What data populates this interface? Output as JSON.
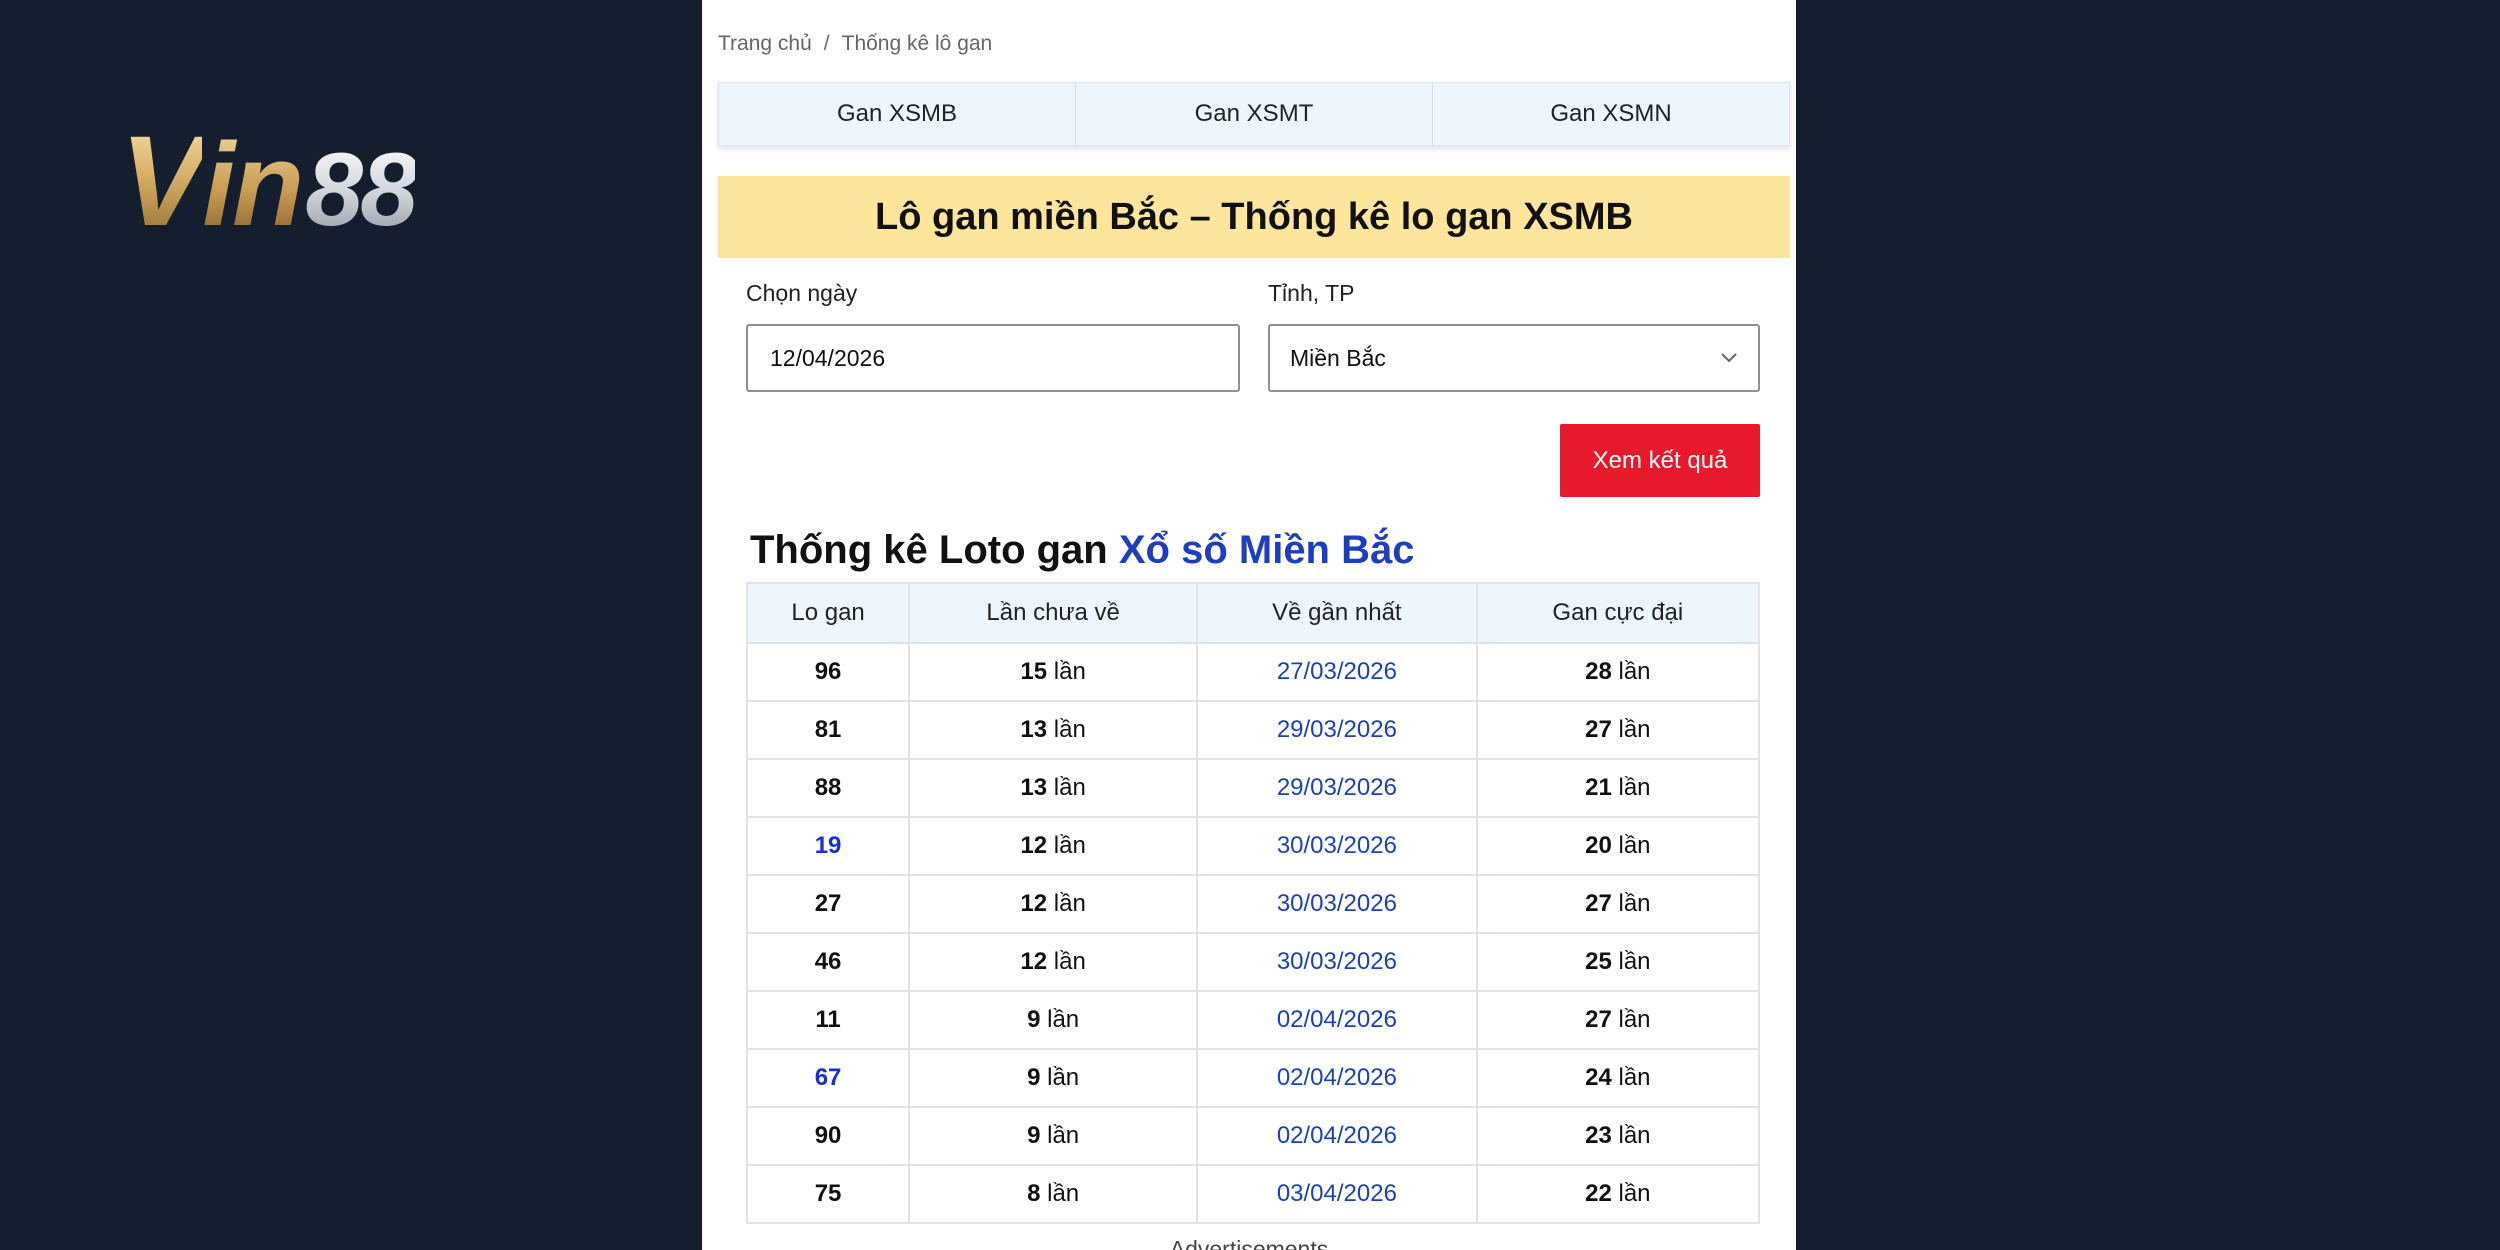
{
  "brand": {
    "logo_v": "V",
    "logo_in": "in",
    "logo_num": "88"
  },
  "breadcrumb": {
    "home": "Trang chủ",
    "separator": "/",
    "current": "Thống kê lô gan"
  },
  "tabs": [
    {
      "label": "Gan XSMB"
    },
    {
      "label": "Gan XSMT"
    },
    {
      "label": "Gan XSMN"
    }
  ],
  "page_title": "Lô gan miền Bắc – Thống kê lo gan XSMB",
  "form": {
    "date_label": "Chọn ngày",
    "date_value": "12/04/2026",
    "province_label": "Tỉnh, TP",
    "province_value": "Miền Bắc",
    "submit_label": "Xem kết quả"
  },
  "section": {
    "title_prefix": "Thống kê Loto gan",
    "title_highlight": "Xổ số Miền Bắc"
  },
  "table": {
    "headers": [
      "Lo gan",
      "Lần chưa về",
      "Về gần nhất",
      "Gan cực đại"
    ],
    "unit": "lần",
    "rows": [
      {
        "lo": "96",
        "count": "15",
        "last": "27/03/2026",
        "max": "28",
        "highlight": false
      },
      {
        "lo": "81",
        "count": "13",
        "last": "29/03/2026",
        "max": "27",
        "highlight": false
      },
      {
        "lo": "88",
        "count": "13",
        "last": "29/03/2026",
        "max": "21",
        "highlight": false
      },
      {
        "lo": "19",
        "count": "12",
        "last": "30/03/2026",
        "max": "20",
        "highlight": true
      },
      {
        "lo": "27",
        "count": "12",
        "last": "30/03/2026",
        "max": "27",
        "highlight": false
      },
      {
        "lo": "46",
        "count": "12",
        "last": "30/03/2026",
        "max": "25",
        "highlight": false
      },
      {
        "lo": "11",
        "count": "9",
        "last": "02/04/2026",
        "max": "27",
        "highlight": false
      },
      {
        "lo": "67",
        "count": "9",
        "last": "02/04/2026",
        "max": "24",
        "highlight": true
      },
      {
        "lo": "90",
        "count": "9",
        "last": "02/04/2026",
        "max": "23",
        "highlight": false
      },
      {
        "lo": "75",
        "count": "8",
        "last": "03/04/2026",
        "max": "22",
        "highlight": false
      }
    ]
  },
  "footer": {
    "ads_label": "Advertisements"
  },
  "colors": {
    "accent_red": "#e8192c",
    "link_blue": "#1d3fbf",
    "title_bg": "#fde59b",
    "page_bg": "#151e2e"
  }
}
